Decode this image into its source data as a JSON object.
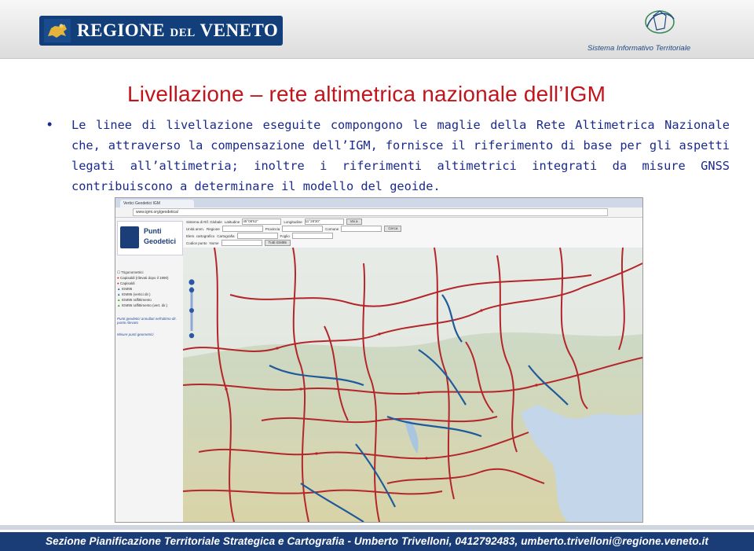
{
  "header": {
    "logo_main": "REGIONE",
    "logo_small": "DEL",
    "logo_end": "VENETO",
    "sit_label": "Sistema Informativo Territoriale"
  },
  "slide": {
    "title": "Livellazione – rete altimetrica nazionale dell’IGM",
    "bullet": "•",
    "body": "Le linee di livellazione eseguite compongono le maglie della Rete Altimetrica Nazionale che, attraverso la compensazione dell’IGM, fornisce il riferimento di base per gli aspetti legati all’altimetria; inoltre i riferimenti altimetrici integrati da misure GNSS contribuiscono a determinare il modello del geoide."
  },
  "screenshot": {
    "tab_title": "Vertici Geodetici IGM",
    "url": "www.igmi.org/geodetica/",
    "brand_line1": "Punti",
    "brand_line2": "Geodetici",
    "form": {
      "row1_label": "Sistema di Rif. Globale",
      "lat_label": "Latitudine",
      "lat_value": "45°08'52\"",
      "lon_label": "Longitudine",
      "lon_value": "11°28'30\"",
      "vai": "Vai a",
      "row2_label": "Unità amm.",
      "regione_label": "Regione",
      "provincia_label": "Provincia",
      "comune_label": "Comune",
      "cerca": "Cerca",
      "row3_label": "Elem. cartografico",
      "carto_value": "Cartografia",
      "foglio_label": "Foglio",
      "row4_label": "Codice punto",
      "nome_label": "Nome",
      "tutti": "Tutti IGM95"
    },
    "layers": [
      "Trigonometrici",
      "Capisaldi (rilevati dopo il 1990)",
      "Capisaldi",
      "IGM95",
      "IGM95 (vertici dir.)",
      "IGM95 raffittimento",
      "IGM95 raffittimento (vert. dir.)"
    ],
    "side_link1": "Punti geodetici annullati nell'ultimo dir. punto rilevato",
    "side_link2": "Misure punti geometrici"
  },
  "footer": {
    "text": "Sezione Pianificazione Territoriale Strategica e Cartografia - Umberto Trivelloni, 0412792483, umberto.trivelloni@regione.veneto.it"
  },
  "colors": {
    "title_red": "#c0151d",
    "body_blue": "#1a2a8c",
    "footer_bg": "#1a3d78",
    "leveling_line": "#b3262a",
    "leveling_line_blue": "#1f5a9a"
  }
}
